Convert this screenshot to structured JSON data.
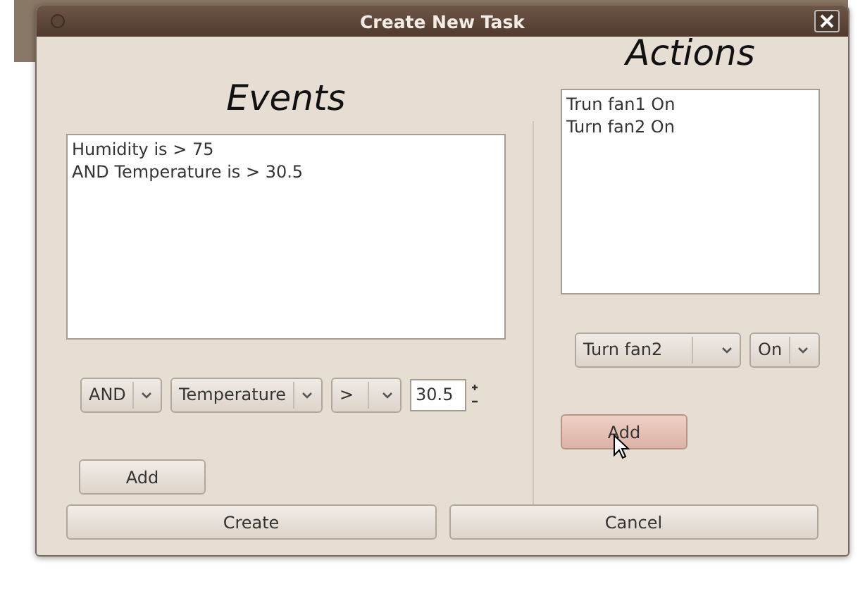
{
  "window": {
    "title": "Create New Task"
  },
  "events": {
    "heading": "Events",
    "items": [
      "Humidity is > 75",
      "AND Temperature is > 30.5"
    ],
    "dropdowns": [
      {
        "value": "AND"
      },
      {
        "value": "Temperature"
      },
      {
        "value": ">"
      }
    ],
    "value_field": {
      "value": "30.5"
    },
    "add_button": {
      "label": "Add",
      "hovered": false
    }
  },
  "actions": {
    "heading": "Actions",
    "items": [
      "Trun fan1 On",
      "Turn fan2 On"
    ],
    "dropdowns": [
      {
        "value": "Turn fan2"
      },
      {
        "value": "On"
      }
    ],
    "add_button": {
      "label": "Add",
      "hovered": true
    }
  },
  "buttons": [
    {
      "label": "Create"
    },
    {
      "label": "Cancel"
    }
  ]
}
